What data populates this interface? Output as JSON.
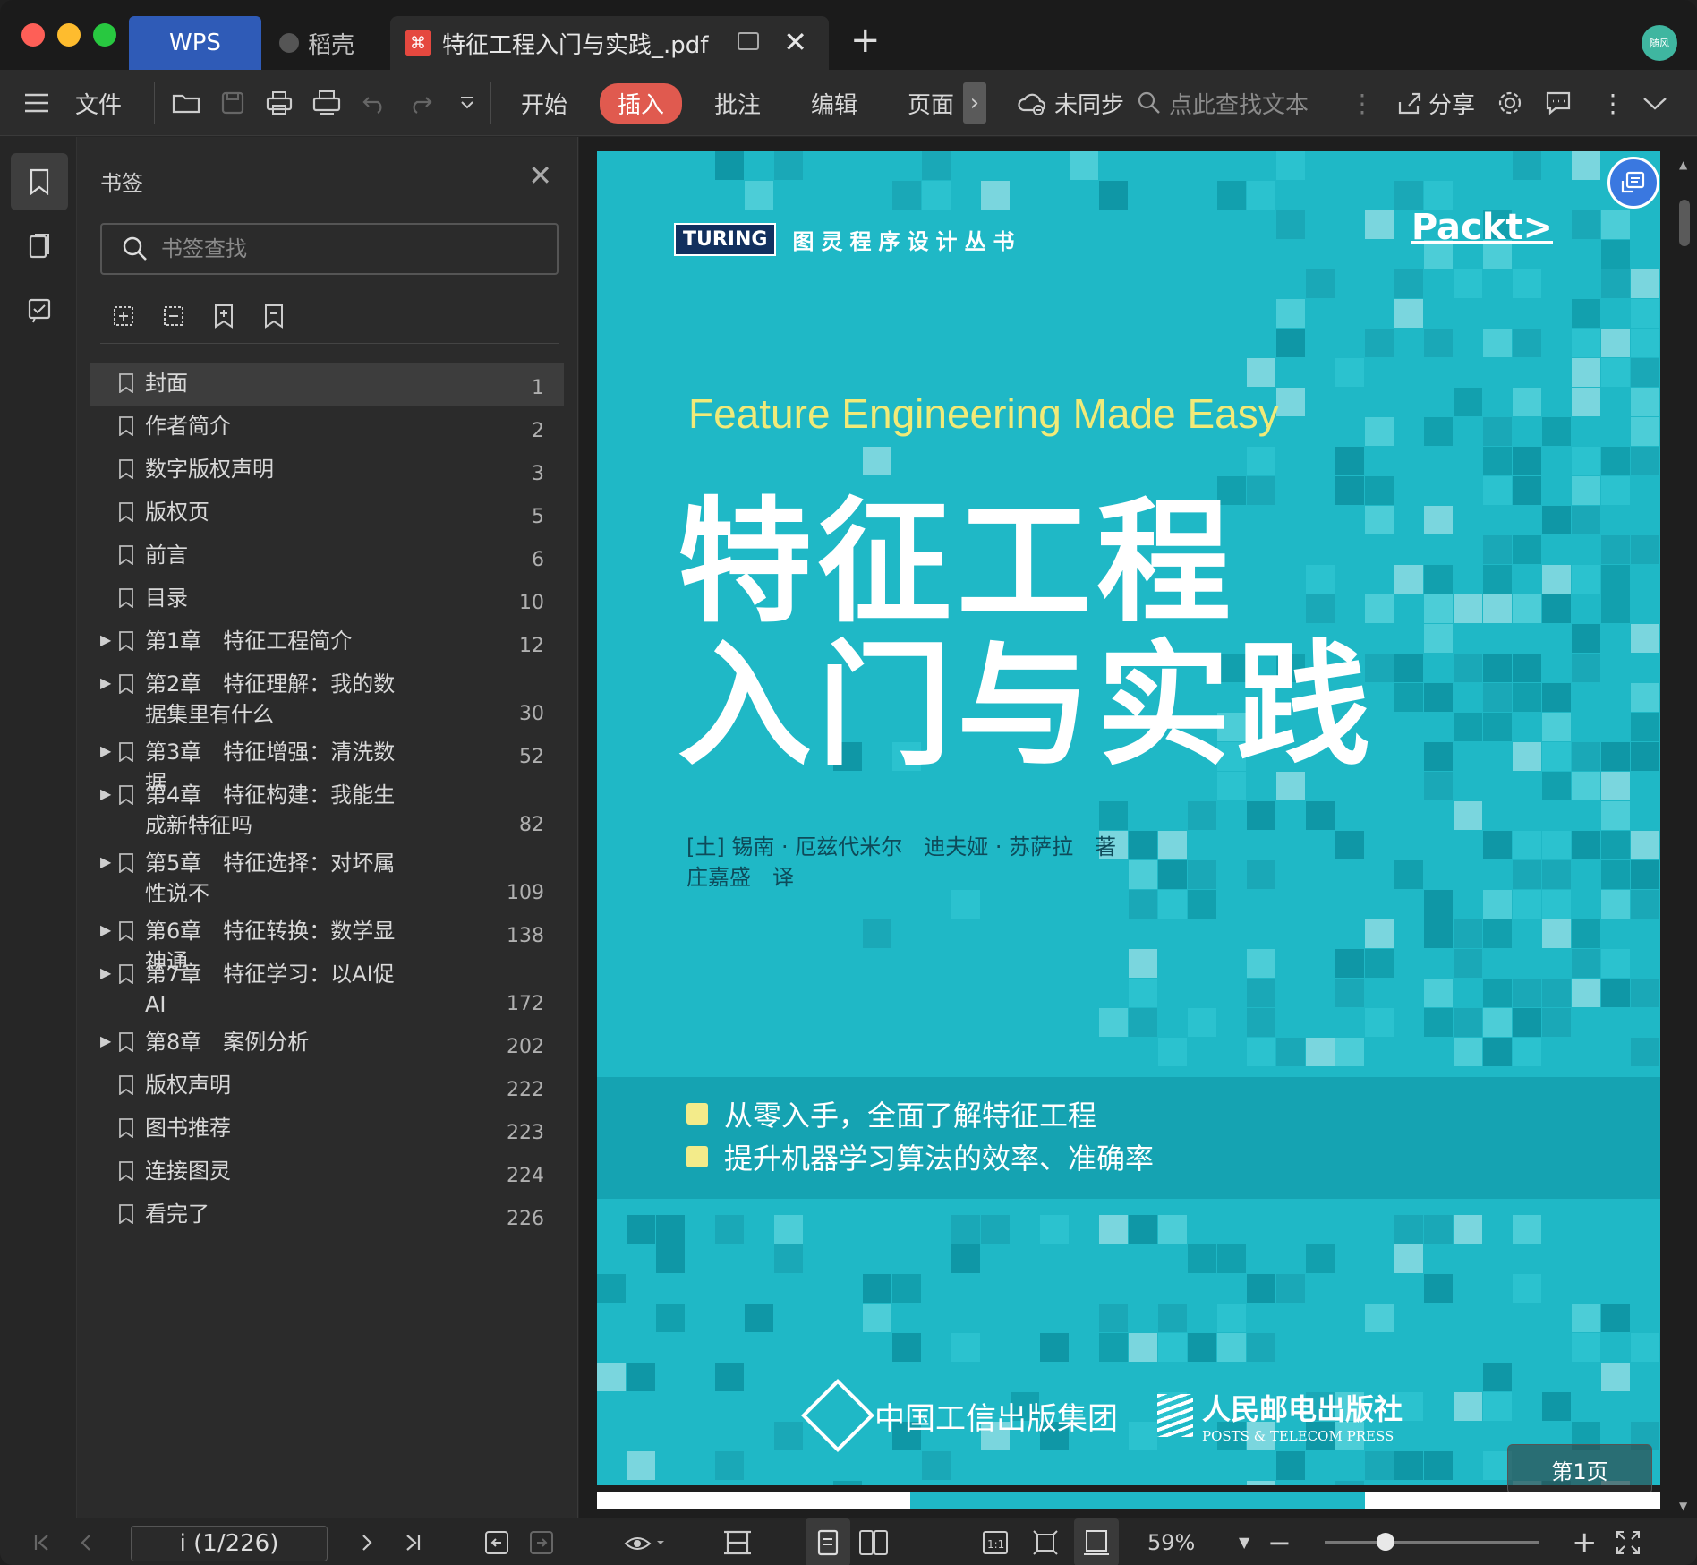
{
  "titlebar": {
    "tabs": [
      {
        "label": "WPS"
      },
      {
        "label": "稻壳"
      },
      {
        "label": "特征工程入门与实践_.pdf"
      }
    ],
    "avatar_text": "随风"
  },
  "toolbar": {
    "file_label": "文件",
    "menu": [
      "开始",
      "插入",
      "批注",
      "编辑",
      "页面"
    ],
    "sync_label": "未同步",
    "search_placeholder": "点此查找文本",
    "share_label": "分享"
  },
  "bookmarks": {
    "title": "书签",
    "search_placeholder": "书签查找",
    "items": [
      {
        "label": "封面",
        "page": "1",
        "expandable": false
      },
      {
        "label": "作者简介",
        "page": "2",
        "expandable": false
      },
      {
        "label": "数字版权声明",
        "page": "3",
        "expandable": false
      },
      {
        "label": "版权页",
        "page": "5",
        "expandable": false
      },
      {
        "label": "前言",
        "page": "6",
        "expandable": false
      },
      {
        "label": "目录",
        "page": "10",
        "expandable": false
      },
      {
        "label": "第1章　特征工程简介",
        "page": "12",
        "expandable": true
      },
      {
        "label": "第2章　特征理解：我的数据集里有什么",
        "page": "30",
        "expandable": true
      },
      {
        "label": "第3章　特征增强：清洗数据",
        "page": "52",
        "expandable": true
      },
      {
        "label": "第4章　特征构建：我能生成新特征吗",
        "page": "82",
        "expandable": true
      },
      {
        "label": "第5章　特征选择：对坏属性说不",
        "page": "109",
        "expandable": true
      },
      {
        "label": "第6章　特征转换：数学显神通",
        "page": "138",
        "expandable": true
      },
      {
        "label": "第7章　特征学习：以AI促AI",
        "page": "172",
        "expandable": true
      },
      {
        "label": "第8章　案例分析",
        "page": "202",
        "expandable": true
      },
      {
        "label": "版权声明",
        "page": "222",
        "expandable": false
      },
      {
        "label": "图书推荐",
        "page": "223",
        "expandable": false
      },
      {
        "label": "连接图灵",
        "page": "224",
        "expandable": false
      },
      {
        "label": "看完了",
        "page": "226",
        "expandable": false
      }
    ]
  },
  "cover": {
    "turing_logo": "TURING",
    "series": "图灵程序设计丛书",
    "packt": "Packt>",
    "english_title": "Feature Engineering Made Easy",
    "title_line1": "特征工程",
    "title_line2": "入门与实践",
    "authors": "[土] 锡南 · 厄兹代米尔　迪夫娅 · 苏萨拉　著",
    "translator": "庄嘉盛　译",
    "features": [
      "从零入手，全面了解特征工程",
      "提升机器学习算法的效率、准确率"
    ],
    "publisher1": "中国工信出版集团",
    "publisher2": "人民邮电出版社",
    "publisher2_en": "POSTS & TELECOM PRESS"
  },
  "viewer": {
    "page_badge": "第1页"
  },
  "statusbar": {
    "page_indicator": "i (1/226)",
    "zoom": "59%"
  }
}
